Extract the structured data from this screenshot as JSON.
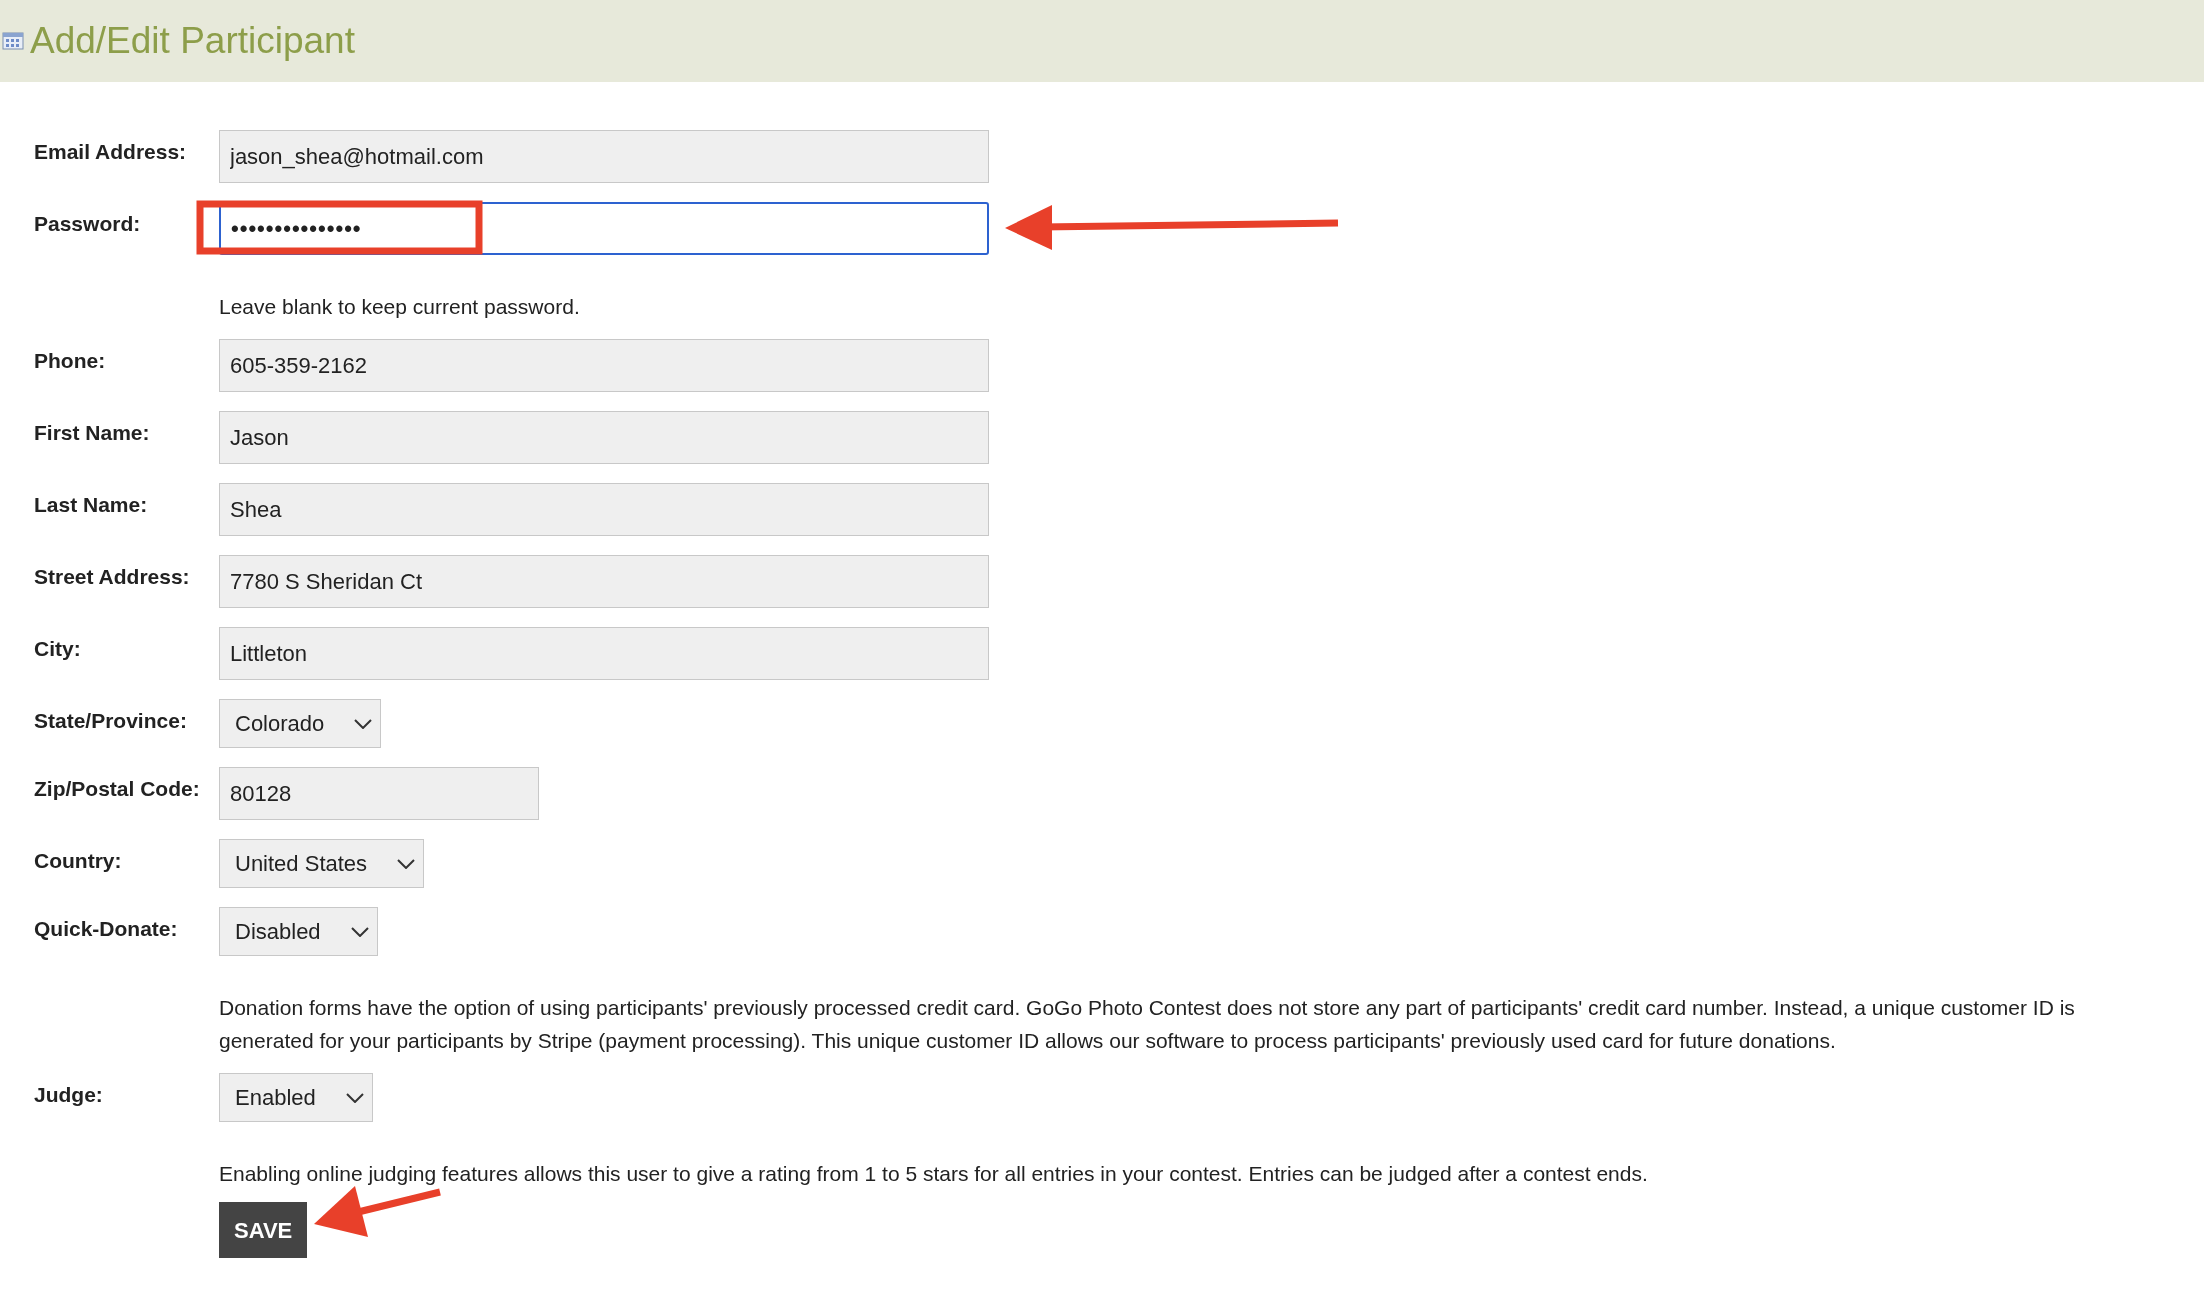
{
  "header": {
    "title": "Add/Edit Participant"
  },
  "fields": [
    {
      "label": "Email Address:",
      "kind": "text",
      "value": "jason_shea@hotmail.com",
      "focused": false
    },
    {
      "label": "Password:",
      "kind": "password",
      "value": "•••••••••••••••",
      "focused": true,
      "note": "Leave blank to keep current password."
    },
    {
      "label": "Phone:",
      "kind": "text",
      "value": "605-359-2162",
      "focused": false
    },
    {
      "label": "First Name:",
      "kind": "text",
      "value": "Jason",
      "focused": false
    },
    {
      "label": "Last Name:",
      "kind": "text",
      "value": "Shea",
      "focused": false
    },
    {
      "label": "Street Address:",
      "kind": "text",
      "value": "7780 S Sheridan Ct",
      "focused": false
    },
    {
      "label": "City:",
      "kind": "text",
      "value": "Littleton",
      "focused": false
    },
    {
      "label": "State/Province:",
      "kind": "select",
      "value": "Colorado",
      "focused": false
    },
    {
      "label": "Zip/Postal Code:",
      "kind": "short",
      "value": "80128",
      "focused": false
    },
    {
      "label": "Country:",
      "kind": "select",
      "value": "United States",
      "focused": false
    },
    {
      "label": "Quick-Donate:",
      "kind": "select",
      "value": "Disabled",
      "focused": false,
      "note": "Donation forms have the option of using participants' previously processed credit card. GoGo Photo Contest does not store any part of participants' credit card number. Instead, a unique customer ID is generated for your participants by Stripe (payment processing). This unique customer ID allows our software to process participants' previously used card for future donations."
    },
    {
      "label": "Judge:",
      "kind": "select",
      "value": "Enabled",
      "focused": false,
      "note": "Enabling online judging features allows this user to give a rating from 1 to 5 stars for all entries in your contest. Entries can be judged after a contest ends."
    }
  ],
  "save_button": "SAVE"
}
